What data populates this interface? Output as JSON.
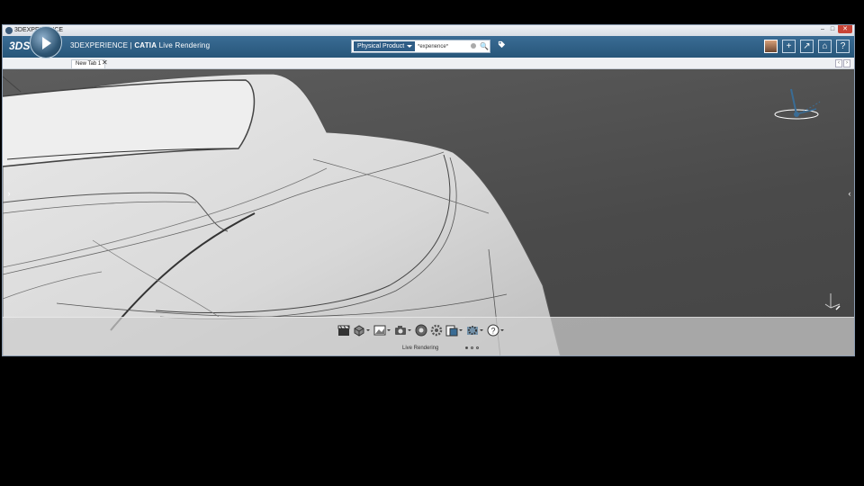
{
  "window": {
    "title": "3DEXPERIENCE",
    "buttons": [
      "–",
      "□",
      "✕"
    ]
  },
  "appbar": {
    "brand_prefix": "3DEXPERIENCE | ",
    "brand_app": "CATIA",
    "brand_suffix": " Live Rendering",
    "search": {
      "category": "Physical Product",
      "value": "*experience*"
    },
    "right_icons": [
      "user-avatar",
      "plus-icon",
      "share-icon",
      "home-icon",
      "help-icon"
    ]
  },
  "tabs": [
    {
      "label": "New Tab 1"
    }
  ],
  "action_bar": {
    "section_label": "Live Rendering",
    "tools": [
      {
        "icon": "clapper-icon"
      },
      {
        "icon": "material-cube-icon"
      },
      {
        "icon": "environment-image-icon"
      },
      {
        "icon": "camera-icon"
      },
      {
        "icon": "render-sphere-icon"
      },
      {
        "icon": "settings-gear-icon"
      },
      {
        "icon": "library-icon"
      },
      {
        "icon": "options-gear-icon"
      },
      {
        "icon": "help-icon"
      }
    ],
    "pages": 3,
    "active_page": 1
  },
  "colors": {
    "appbar": "#2f5f86",
    "viewport": "#4f4f4f",
    "accent": "#3b6f9a"
  }
}
